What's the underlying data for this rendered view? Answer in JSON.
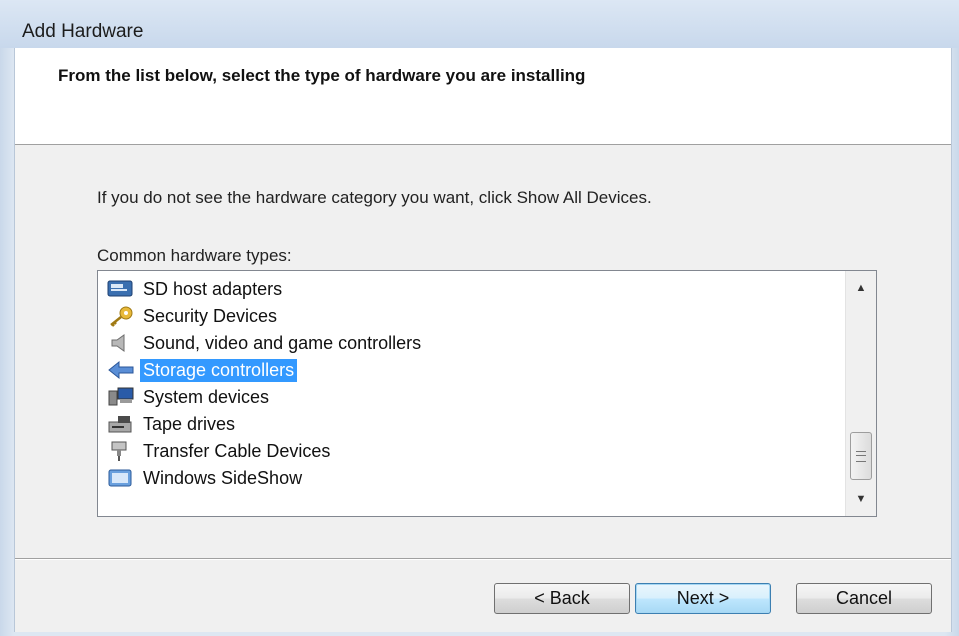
{
  "window": {
    "title": "Add Hardware"
  },
  "header": {
    "title": "From the list below, select the type of hardware you are installing"
  },
  "instruction": "If you do not see the hardware category you want, click Show All Devices.",
  "list": {
    "label": "Common hardware types:",
    "items": [
      {
        "label": "SD host adapters",
        "icon": "sd-card-icon",
        "selected": false
      },
      {
        "label": "Security Devices",
        "icon": "key-icon",
        "selected": false
      },
      {
        "label": "Sound, video and game controllers",
        "icon": "speaker-icon",
        "selected": false
      },
      {
        "label": "Storage controllers",
        "icon": "storage-controller-icon",
        "selected": true
      },
      {
        "label": "System devices",
        "icon": "computer-icon",
        "selected": false
      },
      {
        "label": "Tape drives",
        "icon": "tape-drive-icon",
        "selected": false
      },
      {
        "label": "Transfer Cable Devices",
        "icon": "cable-icon",
        "selected": false
      },
      {
        "label": "Windows SideShow",
        "icon": "sideshow-icon",
        "selected": false
      }
    ]
  },
  "buttons": {
    "back": "< Back",
    "next": "Next >",
    "cancel": "Cancel"
  },
  "colors": {
    "selection": "#3399ff",
    "header_bg": "#ffffff",
    "body_bg": "#f0f0f0"
  }
}
